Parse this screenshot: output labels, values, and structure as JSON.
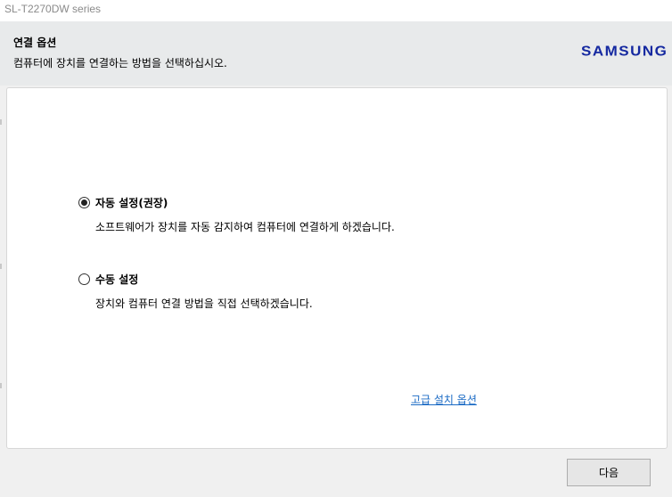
{
  "window": {
    "title": "SL-T2270DW series"
  },
  "header": {
    "title": "연결 옵션",
    "subtitle": "컴퓨터에 장치를 연결하는 방법을 선택하십시오.",
    "brand": "SAMSUNG",
    "brand_color": "#1428a0"
  },
  "options": [
    {
      "label": "자동 설정(권장)",
      "description": "소프트웨어가 장치를 자동 감지하여 컴퓨터에 연결하게 하겠습니다.",
      "selected": true
    },
    {
      "label": "수동 설정",
      "description": "장치와 컴퓨터 연결 방법을 직접 선택하겠습니다.",
      "selected": false
    }
  ],
  "advanced_link": "고급 설치 옵션",
  "buttons": {
    "next": "다음"
  },
  "colors": {
    "link": "#1a6ac4",
    "header_bg": "#e8eaeb"
  }
}
